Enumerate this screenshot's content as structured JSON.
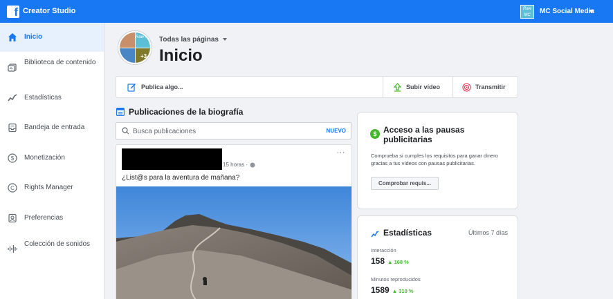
{
  "app": {
    "title": "Creator Studio",
    "page_name": "MC Social Media",
    "page_avatar_text": "Raw MC"
  },
  "sidebar": {
    "items": [
      {
        "label": "Inicio",
        "icon": "home-icon",
        "active": true
      },
      {
        "label": "Biblioteca de contenido",
        "icon": "library-icon",
        "active": false
      },
      {
        "label": "Estadísticas",
        "icon": "insights-icon",
        "active": false
      },
      {
        "label": "Bandeja de entrada",
        "icon": "inbox-icon",
        "active": false
      },
      {
        "label": "Monetización",
        "icon": "dollar-icon",
        "active": false
      },
      {
        "label": "Rights Manager",
        "icon": "copyright-icon",
        "active": false
      },
      {
        "label": "Preferencias",
        "icon": "settings-icon",
        "active": false
      },
      {
        "label": "Colección de sonidos",
        "icon": "sound-icon",
        "active": false
      }
    ]
  },
  "header": {
    "page_selector": "Todas las páginas",
    "title": "Inicio",
    "avatar_badge": "Raw MC",
    "avatar_more": "+3"
  },
  "actions": {
    "post": "Publica algo...",
    "upload": "Subir vídeo",
    "live": "Transmitir"
  },
  "timeline": {
    "title": "Publicaciones de la biografía",
    "search_placeholder": "Busca publicaciones",
    "new_label": "NUEVO"
  },
  "post": {
    "time": "15 horas ·",
    "more": "···",
    "text": "¿List@s para la aventura de mañana?"
  },
  "ad_breaks": {
    "title": "Acceso a las pausas publicitarias",
    "description": "Comprueba si cumples los requisitos para ganar dinero gracias a tus vídeos con pausas publicitarias.",
    "button": "Comprobar requis..."
  },
  "stats": {
    "title": "Estadísticas",
    "period": "Últimos 7 días",
    "metrics": [
      {
        "label": "Interacción",
        "value": "158",
        "delta": "168 %"
      },
      {
        "label": "Minutos reproducidos",
        "value": "1589",
        "delta": "310 %"
      }
    ]
  },
  "colors": {
    "brand": "#1877f2",
    "positive": "#42b72a",
    "sidebar_active_bg": "#e7f0fd"
  }
}
